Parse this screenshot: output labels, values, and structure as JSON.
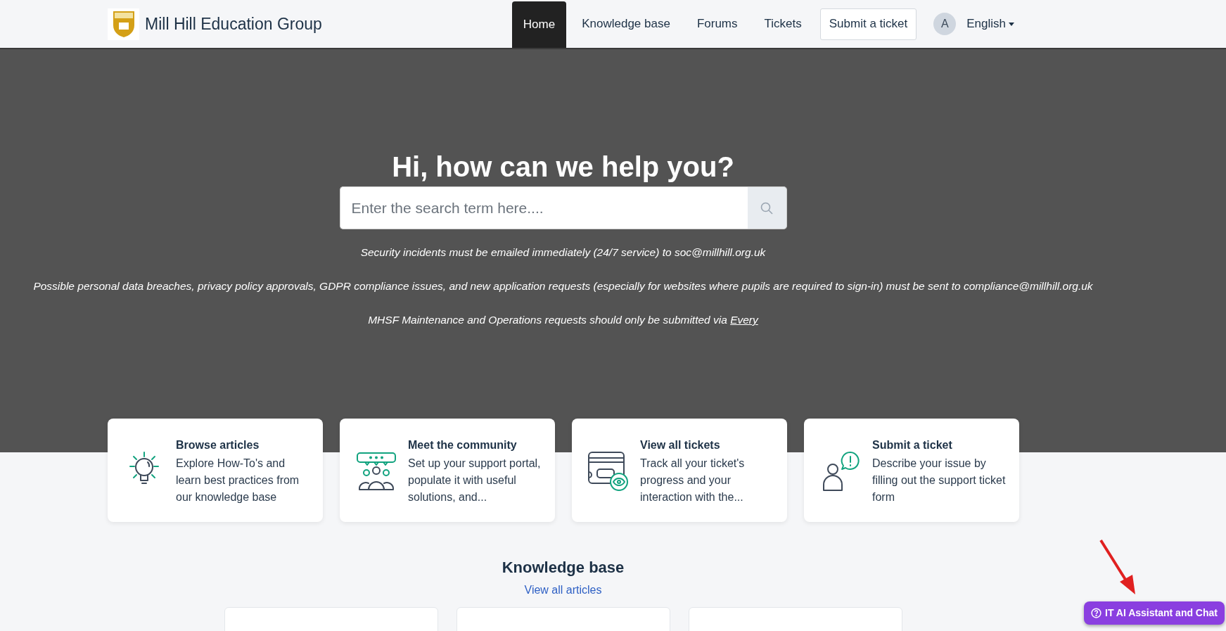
{
  "header": {
    "brand": "Mill Hill Education Group",
    "nav": [
      {
        "label": "Home",
        "selected": true
      },
      {
        "label": "Knowledge base",
        "selected": false
      },
      {
        "label": "Forums",
        "selected": false
      },
      {
        "label": "Tickets",
        "selected": false
      }
    ],
    "submit_button": "Submit a ticket",
    "avatar": "A",
    "language": "English"
  },
  "hero": {
    "title": "Hi, how can we help you?",
    "search": {
      "placeholder": "Enter the search term here...."
    },
    "notices": [
      {
        "text": "Security incidents must be emailed immediately (24/7 service) to soc@millhill.org.uk"
      },
      {
        "text": "Possible personal data breaches, privacy policy approvals, GDPR compliance issues, and new application requests (especially for websites where pupils are required to sign-in) must be sent to compliance@millhill.org.uk"
      },
      {
        "text": "MHSF Maintenance and Operations requests should only be submitted via",
        "link": "Every"
      }
    ]
  },
  "cards": [
    {
      "kind": "lightbulb",
      "title": "Browse articles",
      "text": "Explore How-To's and learn best practices from our knowledge base"
    },
    {
      "kind": "community",
      "title": "Meet the community",
      "text": "Set up your support portal, populate it with useful solutions, and..."
    },
    {
      "kind": "tickets",
      "title": "View all tickets",
      "text": "Track all your ticket's progress and your interaction with the..."
    },
    {
      "kind": "person-alert",
      "title": "Submit a ticket",
      "text": "Describe your issue by filling out the support ticket form"
    }
  ],
  "knowledge_base": {
    "title": "Knowledge base",
    "link": "View all articles"
  },
  "chat_button": "IT AI Assistant and Chat"
}
